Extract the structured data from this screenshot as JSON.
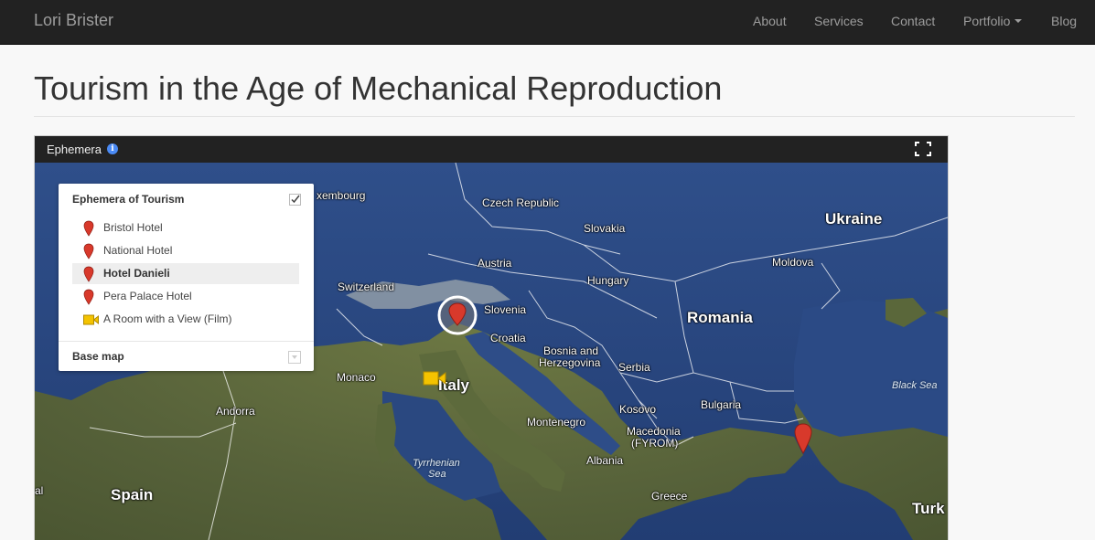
{
  "navbar": {
    "brand": "Lori Brister",
    "links": [
      "About",
      "Services",
      "Contact",
      "Portfolio",
      "Blog"
    ]
  },
  "page": {
    "title": "Tourism in the Age of Mechanical Reproduction"
  },
  "map": {
    "title": "Ephemera",
    "legend": {
      "title": "Ephemera of Tourism",
      "items": [
        {
          "label": "Bristol Hotel",
          "icon": "map-pin-icon"
        },
        {
          "label": "National Hotel",
          "icon": "map-pin-icon"
        },
        {
          "label": "Hotel Danieli",
          "icon": "map-pin-icon",
          "selected": true
        },
        {
          "label": "Pera Palace Hotel",
          "icon": "map-pin-icon"
        },
        {
          "label": "A Room with a View (Film)",
          "icon": "video-camera-icon"
        }
      ],
      "base_map_label": "Base map"
    },
    "labels": {
      "luxembourg": "xembourg",
      "czech_republic": "Czech Republic",
      "slovakia": "Slovakia",
      "ukraine": "Ukraine",
      "austria": "Austria",
      "moldova": "Moldova",
      "switzerland": "Switzerland",
      "hungary": "Hungary",
      "slovenia": "Slovenia",
      "romania": "Romania",
      "croatia": "Croatia",
      "bosnia": "Bosnia and Herzegovina",
      "bosnia_line1": "Bosnia and",
      "bosnia_line2": "Herzegovina",
      "monaco": "Monaco",
      "italy": "Italy",
      "serbia": "Serbia",
      "black_sea": "Black Sea",
      "andorra": "Andorra",
      "montenegro": "Montenegro",
      "kosovo": "Kosovo",
      "bulgaria": "Bulgaria",
      "macedonia_line1": "Macedonia",
      "macedonia_line2": "(FYROM)",
      "tyrrhenian_line1": "Tyrrhenian",
      "tyrrhenian_line2": "Sea",
      "albania": "Albania",
      "portugal_partial": "al",
      "spain": "Spain",
      "greece": "Greece",
      "turkey_partial": "Turk"
    },
    "colors": {
      "land": "#5f6b3e",
      "sea": "#2d4a82",
      "marker": "#d8392b",
      "film_marker": "#f4c300",
      "info": "#4a8af4"
    }
  }
}
